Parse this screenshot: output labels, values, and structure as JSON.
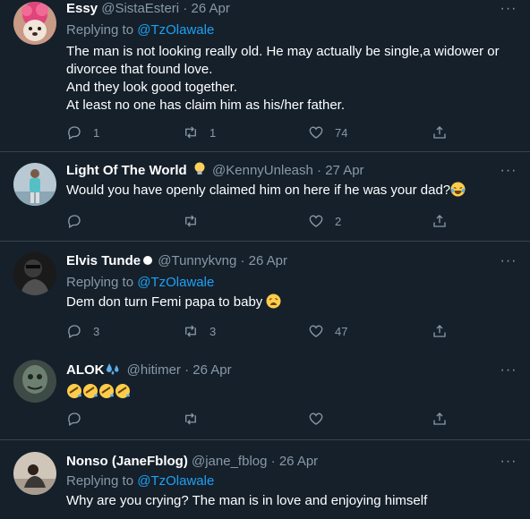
{
  "tweets": [
    {
      "name": "Essy",
      "handle": "@SistaEsteri",
      "date": "26 Apr",
      "replying_prefix": "Replying to",
      "replying_to": "@TzOlawale",
      "lines": [
        "The man is not looking really old. He may actually be single,a widower or",
        "divorcee that found love.",
        "And they look good together.",
        "At least no one has claim him as his/her father."
      ],
      "replies": "1",
      "retweets": "1",
      "likes": "74"
    },
    {
      "name": "Light Of The World",
      "name_emoji": "lightbulb-emoji",
      "handle": "@KennyUnleash",
      "date": "27 Apr",
      "lines": [
        "Would you have openly claimed him on here if he was your dad?"
      ],
      "text_emoji": "tears-of-joy-emoji",
      "replies": "",
      "retweets": "",
      "likes": "2"
    },
    {
      "name": "Elvis Tunde",
      "handle": "@Tunnykvng",
      "date": "26 Apr",
      "replying_prefix": "Replying to",
      "replying_to": "@TzOlawale",
      "lines": [
        "Dem don turn Femi papa to baby"
      ],
      "text_emoji": "weary-face-emoji",
      "replies": "3",
      "retweets": "3",
      "likes": "47"
    },
    {
      "name": "ALOK",
      "name_emoji": "sweat-droplets-emoji",
      "handle": "@hitimer",
      "date": "26 Apr",
      "lines": [
        ""
      ],
      "text_emoji": "rolling-on-floor-laughing-emoji",
      "replies": "",
      "retweets": "",
      "likes": ""
    },
    {
      "name": "Nonso (JaneFblog)",
      "handle": "@jane_fblog",
      "date": "26 Apr",
      "replying_prefix": "Replying to",
      "replying_to": "@TzOlawale",
      "lines": [
        "Why are you crying? The man is in love and enjoying himself"
      ]
    }
  ],
  "separator": "·",
  "more_label": "···",
  "colors": {
    "background": "#15202b",
    "border": "#38444d",
    "muted": "#8899a6",
    "link": "#1da1f2"
  }
}
